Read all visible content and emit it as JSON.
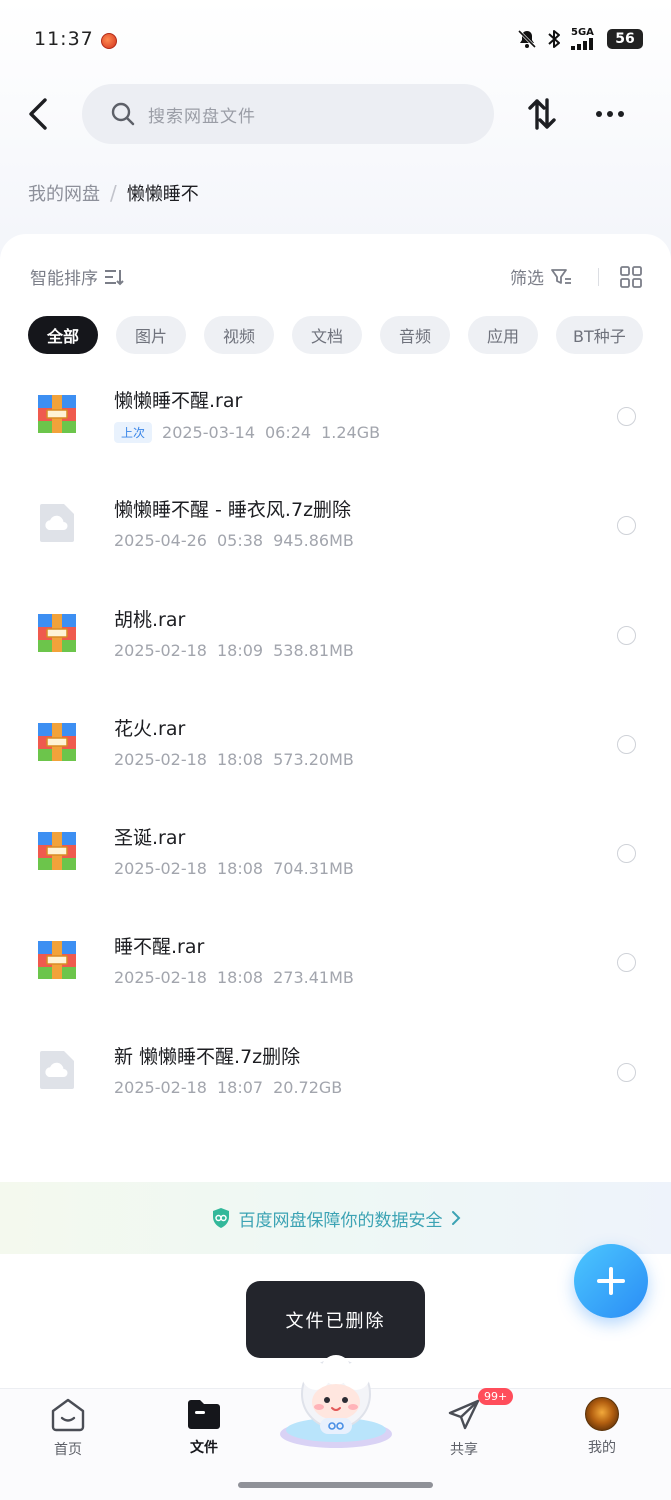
{
  "status_bar": {
    "time": "11:37",
    "network_label": "5GA",
    "battery": "56"
  },
  "header": {
    "search_placeholder": "搜索网盘文件"
  },
  "breadcrumb": {
    "root": "我的网盘",
    "separator": "/",
    "current": "懒懒睡不"
  },
  "toolbar": {
    "sort_label": "智能排序",
    "filter_label": "筛选"
  },
  "chips": [
    {
      "label": "全部",
      "active": true
    },
    {
      "label": "图片",
      "active": false
    },
    {
      "label": "视频",
      "active": false
    },
    {
      "label": "文档",
      "active": false
    },
    {
      "label": "音频",
      "active": false
    },
    {
      "label": "应用",
      "active": false
    },
    {
      "label": "BT种子",
      "active": false
    }
  ],
  "files": [
    {
      "name": "懒懒睡不醒.rar",
      "tag": "上次",
      "date": "2025-03-14",
      "time": "06:24",
      "size": "1.24GB",
      "icon": "archive-icon"
    },
    {
      "name": "懒懒睡不醒 - 睡衣风.7z删除",
      "tag": "",
      "date": "2025-04-26",
      "time": "05:38",
      "size": "945.86MB",
      "icon": "cloud-file-icon"
    },
    {
      "name": "胡桃.rar",
      "tag": "",
      "date": "2025-02-18",
      "time": "18:09",
      "size": "538.81MB",
      "icon": "archive-icon"
    },
    {
      "name": "花火.rar",
      "tag": "",
      "date": "2025-02-18",
      "time": "18:08",
      "size": "573.20MB",
      "icon": "archive-icon"
    },
    {
      "name": "圣诞.rar",
      "tag": "",
      "date": "2025-02-18",
      "time": "18:08",
      "size": "704.31MB",
      "icon": "archive-icon"
    },
    {
      "name": "睡不醒.rar",
      "tag": "",
      "date": "2025-02-18",
      "time": "18:08",
      "size": "273.41MB",
      "icon": "archive-icon"
    },
    {
      "name": "新 懒懒睡不醒.7z删除",
      "tag": "",
      "date": "2025-02-18",
      "time": "18:07",
      "size": "20.72GB",
      "icon": "cloud-file-icon"
    }
  ],
  "security_banner": {
    "text": "百度网盘保障你的数据安全",
    "icon": "shield-icon"
  },
  "toast": {
    "text": "文件已删除"
  },
  "bottom_nav": {
    "items": [
      {
        "label": "首页",
        "icon": "home-icon",
        "active": false
      },
      {
        "label": "文件",
        "icon": "folder-icon",
        "active": true
      },
      {
        "label": "",
        "icon": "mascot-icon",
        "active": false
      },
      {
        "label": "共享",
        "icon": "share-icon",
        "active": false
      },
      {
        "label": "我的",
        "icon": "avatar",
        "active": false
      }
    ],
    "share_badge": "99+"
  },
  "colors": {
    "accent": "#2a8cf5",
    "active_chip": "#15161b",
    "tag_blue": "#3a86e8",
    "badge_red": "#ff4d5b"
  }
}
